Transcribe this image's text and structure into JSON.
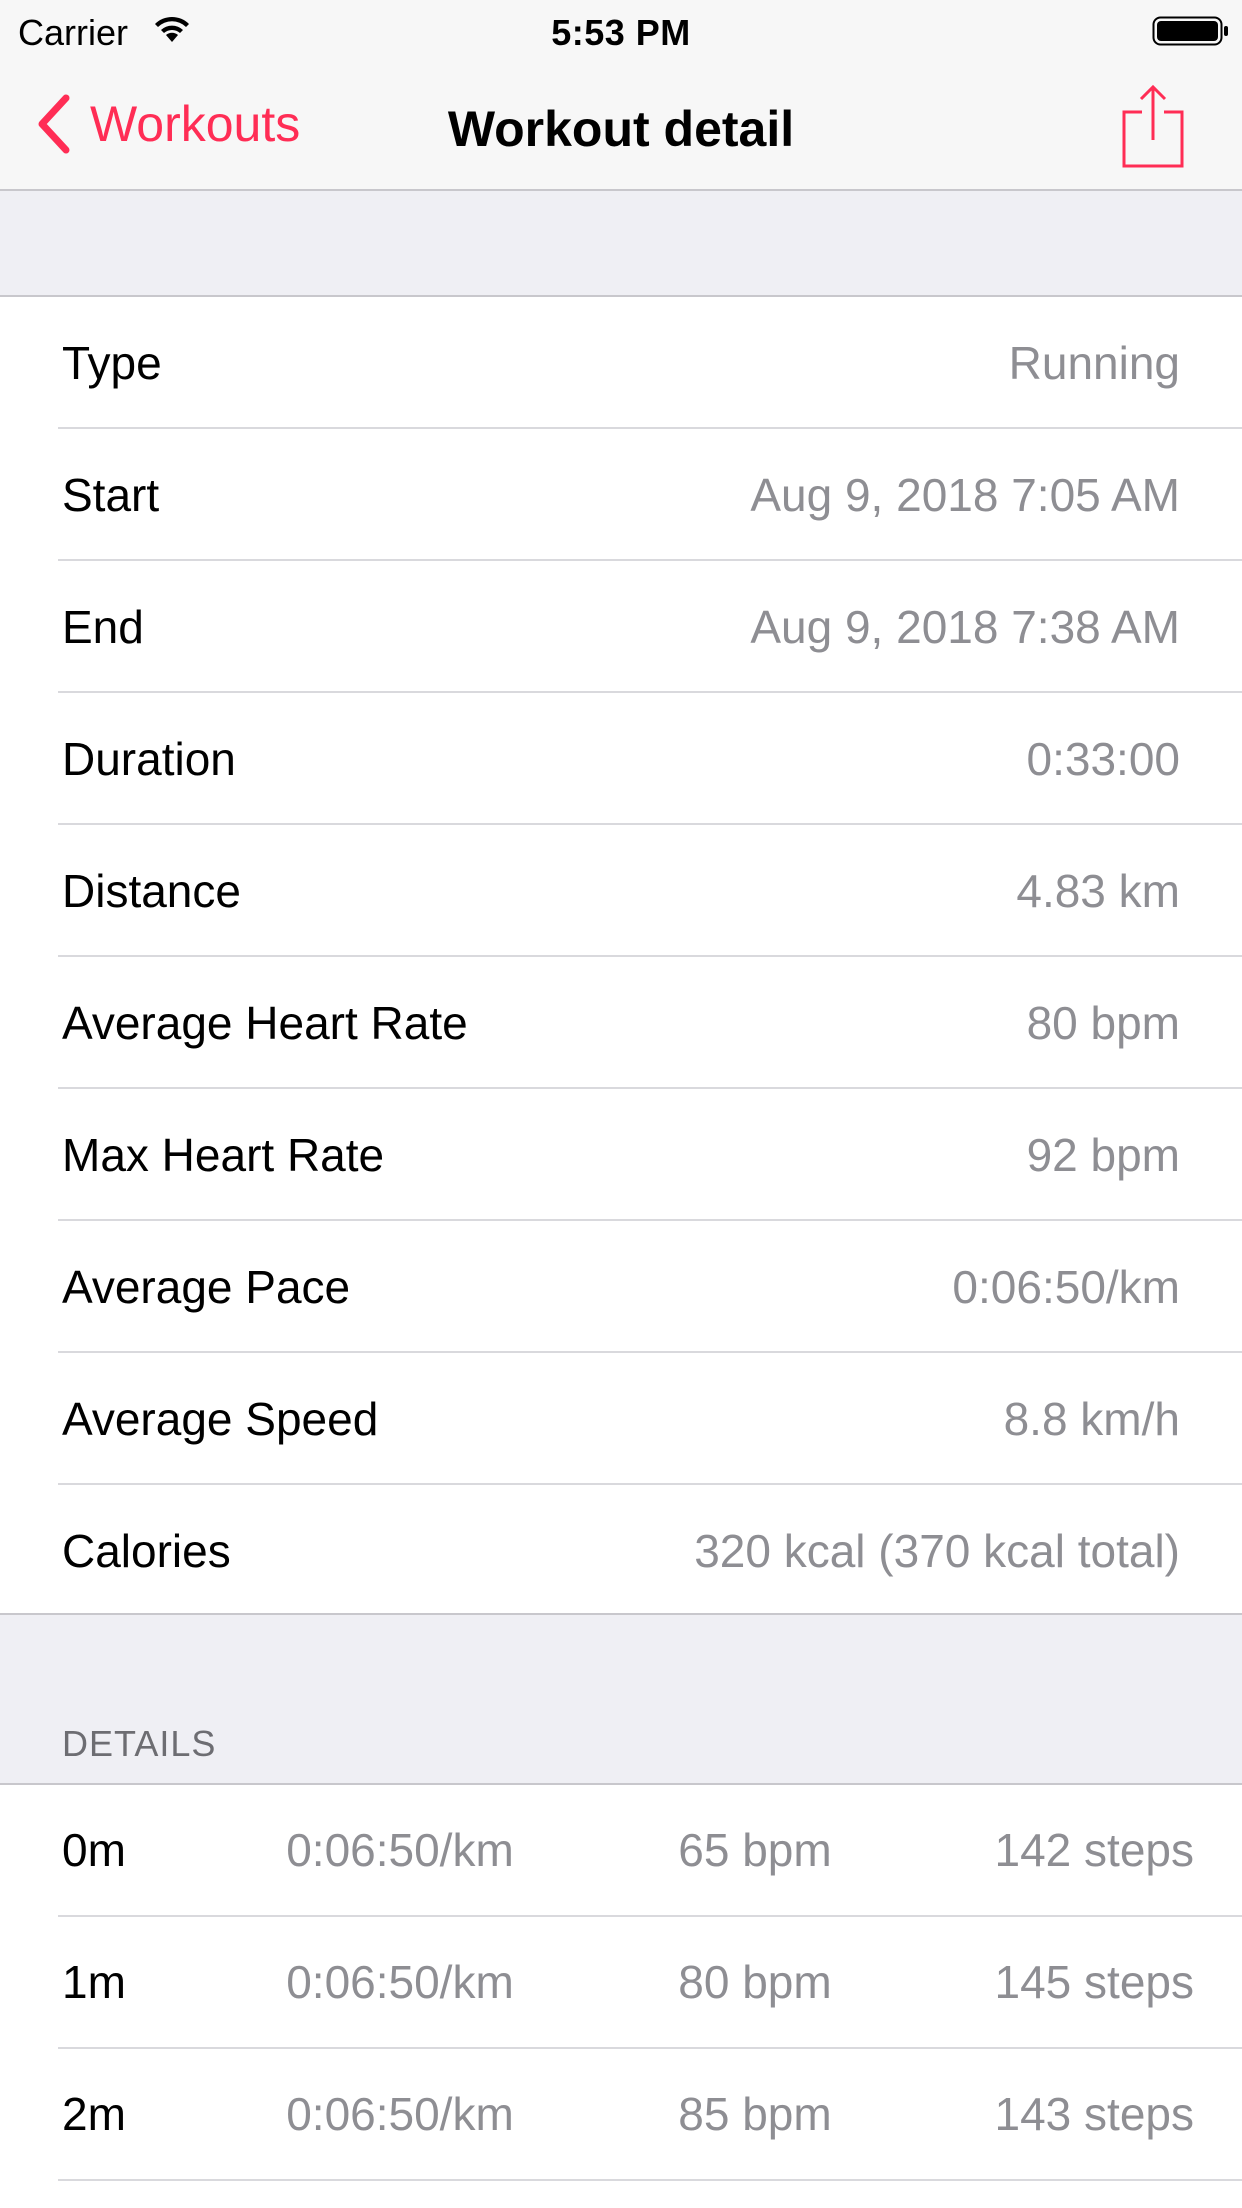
{
  "status_bar": {
    "carrier": "Carrier",
    "time": "5:53 PM",
    "icons": [
      "wifi-icon",
      "battery-icon"
    ]
  },
  "nav": {
    "back_label": "Workouts",
    "title": "Workout detail",
    "share_icon": "share-icon",
    "accent_color": "#ff2d55"
  },
  "summary": [
    {
      "label": "Type",
      "value": "Running"
    },
    {
      "label": "Start",
      "value": "Aug 9, 2018 7:05 AM"
    },
    {
      "label": "End",
      "value": "Aug 9, 2018 7:38 AM"
    },
    {
      "label": "Duration",
      "value": "0:33:00"
    },
    {
      "label": "Distance",
      "value": "4.83 km"
    },
    {
      "label": "Average Heart Rate",
      "value": "80 bpm"
    },
    {
      "label": "Max Heart Rate",
      "value": "92 bpm"
    },
    {
      "label": "Average Pace",
      "value": "0:06:50/km"
    },
    {
      "label": "Average Speed",
      "value": "8.8 km/h"
    },
    {
      "label": "Calories",
      "value": "320 kcal (370 kcal total)"
    }
  ],
  "details": {
    "header": "DETAILS",
    "rows": [
      {
        "time": "0m",
        "pace": "0:06:50/km",
        "heart_rate": "65 bpm",
        "steps": "142 steps"
      },
      {
        "time": "1m",
        "pace": "0:06:50/km",
        "heart_rate": "80 bpm",
        "steps": "145 steps"
      },
      {
        "time": "2m",
        "pace": "0:06:50/km",
        "heart_rate": "85 bpm",
        "steps": "143 steps"
      }
    ]
  }
}
